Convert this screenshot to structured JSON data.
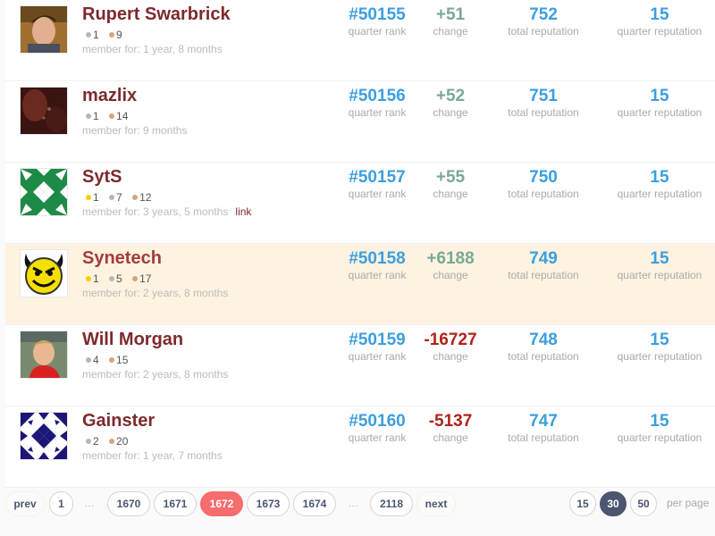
{
  "labels": {
    "quarter_rank": "quarter rank",
    "change": "change",
    "total_reputation": "total reputation",
    "quarter_reputation": "quarter reputation"
  },
  "users": [
    {
      "name": "Rupert Swarbrick",
      "avatar": "photo-avatar",
      "badges": {
        "gold": null,
        "silver": "1",
        "bronze": "9"
      },
      "member_for": "member for: 1 year, 8 months",
      "link": null,
      "quarter_rank": "#50155",
      "change": "+51",
      "change_sign": "pos",
      "total_reputation": "752",
      "quarter_reputation": "15",
      "highlighted": false
    },
    {
      "name": "mazlix",
      "avatar": "photo-avatar",
      "badges": {
        "gold": null,
        "silver": "1",
        "bronze": "14"
      },
      "member_for": "member for: 9 months",
      "link": null,
      "quarter_rank": "#50156",
      "change": "+52",
      "change_sign": "pos",
      "total_reputation": "751",
      "quarter_reputation": "15",
      "highlighted": false
    },
    {
      "name": "SytS",
      "avatar": "identicon-green",
      "badges": {
        "gold": "1",
        "silver": "7",
        "bronze": "12"
      },
      "member_for": "member for: 3 years, 5 months",
      "link": "link",
      "quarter_rank": "#50157",
      "change": "+55",
      "change_sign": "pos",
      "total_reputation": "750",
      "quarter_reputation": "15",
      "highlighted": false
    },
    {
      "name": "Synetech",
      "avatar": "devil-smiley",
      "badges": {
        "gold": "1",
        "silver": "5",
        "bronze": "17"
      },
      "member_for": "member for: 2 years, 8 months",
      "link": null,
      "quarter_rank": "#50158",
      "change": "+6188",
      "change_sign": "pos",
      "total_reputation": "749",
      "quarter_reputation": "15",
      "highlighted": true
    },
    {
      "name": "Will Morgan",
      "avatar": "photo-avatar",
      "badges": {
        "gold": null,
        "silver": "4",
        "bronze": "15"
      },
      "member_for": "member for: 2 years, 8 months",
      "link": null,
      "quarter_rank": "#50159",
      "change": "-16727",
      "change_sign": "neg",
      "total_reputation": "748",
      "quarter_reputation": "15",
      "highlighted": false
    },
    {
      "name": "Gainster",
      "avatar": "identicon-navy",
      "badges": {
        "gold": null,
        "silver": "2",
        "bronze": "20"
      },
      "member_for": "member for: 1 year, 7 months",
      "link": null,
      "quarter_rank": "#50160",
      "change": "-5137",
      "change_sign": "neg",
      "total_reputation": "747",
      "quarter_reputation": "15",
      "highlighted": false
    }
  ],
  "pager": {
    "prev": "prev",
    "next": "next",
    "ellipsis": "…",
    "pages": [
      "1",
      "1670",
      "1671",
      "1672",
      "1673",
      "1674",
      "2118"
    ],
    "current_page": "1672",
    "per_page_options": [
      "15",
      "30",
      "50"
    ],
    "per_page_selected": "30",
    "per_page_label": "per page"
  },
  "colors": {
    "username": "#7d2a2e",
    "stat_value": "#3b9fe0",
    "change_positive": "#7aa896",
    "change_negative": "#b02418",
    "highlight_row": "#fdf3e0",
    "current_page": "#f76c6d",
    "selected_per_page": "#4c5670"
  }
}
